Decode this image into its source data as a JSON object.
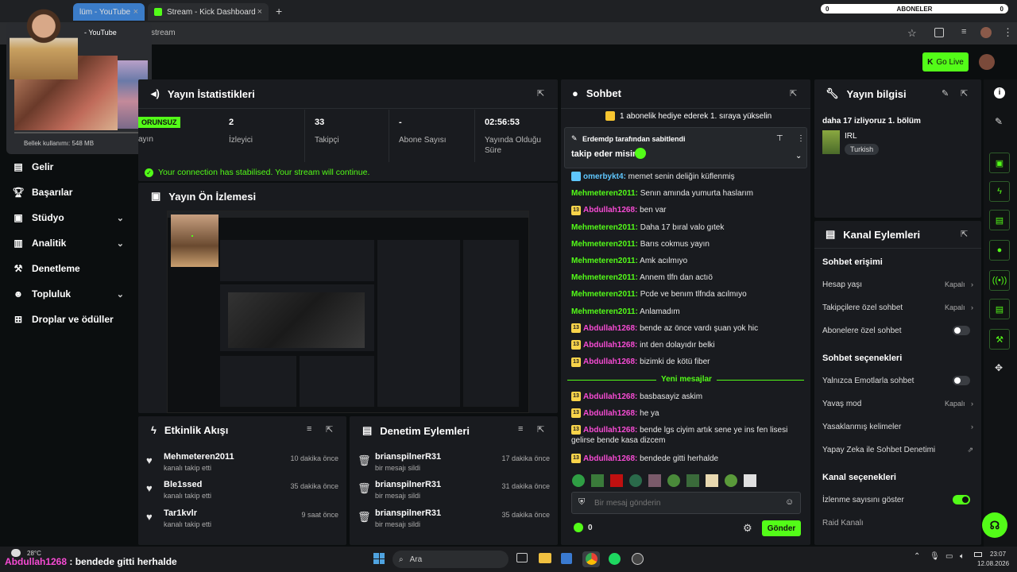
{
  "browser": {
    "tabs": [
      {
        "label": "lüm - YouTube",
        "close": "×"
      },
      {
        "label": "Stream - Kick Dashboard",
        "close": "×"
      }
    ],
    "new_tab": "+",
    "address": "stream"
  },
  "pip": {
    "title": "- YouTube",
    "memory": "Bellek kullanımı: 548 MB"
  },
  "counter": {
    "left": "0",
    "title": "ABONELER",
    "right": "0"
  },
  "header": {
    "go_live": "Go Live"
  },
  "sidebar": {
    "items": [
      {
        "label": "Gelir",
        "icon": "wallet-icon"
      },
      {
        "label": "Başarılar",
        "icon": "trophy-icon"
      },
      {
        "label": "Stüdyo",
        "icon": "studio-icon",
        "chevron": "⌄"
      },
      {
        "label": "Analitik",
        "icon": "chart-icon",
        "chevron": "⌄"
      },
      {
        "label": "Denetleme",
        "icon": "hammer-icon"
      },
      {
        "label": "Topluluk",
        "icon": "people-icon",
        "chevron": "⌄"
      },
      {
        "label": "Droplar ve ödüller",
        "icon": "gift-icon"
      }
    ]
  },
  "stats": {
    "title": "Yayın İstatistikleri",
    "badge": "ORUNSUZ",
    "items": [
      {
        "value": "",
        "label": "ayın"
      },
      {
        "value": "2",
        "label": "İzleyici"
      },
      {
        "value": "33",
        "label": "Takipçi"
      },
      {
        "value": "-",
        "label": "Abone Sayısı"
      },
      {
        "value": "02:56:53",
        "label": "Yayında Olduğu Süre"
      }
    ],
    "notice": "Your connection has stabilised. Your stream will continue."
  },
  "preview": {
    "title": "Yayın Ön İzlemesi"
  },
  "activity": {
    "title": "Etkinlik Akışı",
    "items": [
      {
        "name": "Mehmeteren2011",
        "sub": "kanalı takip etti",
        "time": "10 dakika önce"
      },
      {
        "name": "Ble1ssed",
        "sub": "kanalı takip etti",
        "time": "35 dakika önce"
      },
      {
        "name": "Tar1kvlr",
        "sub": "kanalı takip etti",
        "time": "9 saat önce"
      }
    ]
  },
  "moderation": {
    "title": "Denetim Eylemleri",
    "items": [
      {
        "name": "brianspilnerR31",
        "sub": "bir mesajı sildi",
        "time": "17 dakika önce"
      },
      {
        "name": "brianspilnerR31",
        "sub": "bir mesajı sildi",
        "time": "31 dakika önce"
      },
      {
        "name": "brianspilnerR31",
        "sub": "bir mesajı sildi",
        "time": "35 dakika önce"
      }
    ]
  },
  "chat": {
    "title": "Sohbet",
    "sub_banner": "1 abonelik hediye ederek 1. sıraya yükselin",
    "pinned_by": "Erdemdp tarafından sabitlendi",
    "pinned_text": "takip eder misin",
    "messages": [
      {
        "user": "omerbykt4:",
        "text": " memet senin deliğin küflenmiş",
        "color": "b",
        "badge": ""
      },
      {
        "user": "Mehmeteren2011:",
        "text": " Senın amında yumurta haslarım",
        "color": "g",
        "badge": ""
      },
      {
        "user": "Abdullah1268:",
        "text": " ben var",
        "color": "p",
        "badge": "13"
      },
      {
        "user": "Mehmeteren2011:",
        "text": " Daha 17 bıral valo gıtek",
        "color": "g",
        "badge": ""
      },
      {
        "user": "Mehmeteren2011:",
        "text": " Barıs cokmus yayın",
        "color": "g",
        "badge": ""
      },
      {
        "user": "Mehmeteren2011:",
        "text": " Amk acılmıyo",
        "color": "g",
        "badge": ""
      },
      {
        "user": "Mehmeteren2011:",
        "text": " Annem tlfn dan actıö",
        "color": "g",
        "badge": ""
      },
      {
        "user": "Mehmeteren2011:",
        "text": " Pcde ve benım tlfnda acılmıyo",
        "color": "g",
        "badge": ""
      },
      {
        "user": "Mehmeteren2011:",
        "text": " Anlamadım",
        "color": "g",
        "badge": ""
      },
      {
        "user": "Abdullah1268:",
        "text": " bende az önce vardı şuan yok hic",
        "color": "p",
        "badge": "13"
      },
      {
        "user": "Abdullah1268:",
        "text": " int den dolayıdır belki",
        "color": "p",
        "badge": "13"
      },
      {
        "user": "Abdullah1268:",
        "text": " bizimki de kötü fiber",
        "color": "p",
        "badge": "13"
      }
    ],
    "new_messages": "Yeni mesajlar",
    "messages_after": [
      {
        "user": "Abdullah1268:",
        "text": " basbasayiz askim",
        "color": "p",
        "badge": "13"
      },
      {
        "user": "Abdullah1268:",
        "text": " he ya",
        "color": "p",
        "badge": "13"
      },
      {
        "user": "Abdullah1268:",
        "text": " bende lgs ciyim artık sene ye ins fen lisesi gelirse bende kasa dizcem",
        "color": "p",
        "badge": "13"
      },
      {
        "user": "Abdullah1268:",
        "text": " bendede gitti herhalde",
        "color": "p",
        "badge": "13"
      }
    ],
    "placeholder": "Bir mesaj gönderin",
    "points": "0",
    "send": "Gönder"
  },
  "stream_info": {
    "title": "Yayın bilgisi",
    "stream_title": "daha 17 izliyoruz 1. bölüm",
    "category": "IRL",
    "tag": "Turkish"
  },
  "channel_actions": {
    "title": "Kanal Eylemleri",
    "access_heading": "Sohbet erişimi",
    "access_rows": [
      {
        "label": "Hesap yaşı",
        "value": "Kapalı",
        "kind": "chevron"
      },
      {
        "label": "Takipçilere özel sohbet",
        "value": "Kapalı",
        "kind": "chevron"
      },
      {
        "label": "Abonelere özel sohbet",
        "value": "",
        "kind": "toggle-off"
      }
    ],
    "options_heading": "Sohbet seçenekleri",
    "options_rows": [
      {
        "label": "Yalnızca Emotlarla sohbet",
        "value": "",
        "kind": "toggle-off"
      },
      {
        "label": "Yavaş mod",
        "value": "Kapalı",
        "kind": "chevron"
      },
      {
        "label": "Yasaklanmış kelimeler",
        "value": "",
        "kind": "chevron"
      },
      {
        "label": "Yapay Zeka ile Sohbet Denetimi",
        "value": "",
        "kind": "external"
      }
    ],
    "channel_heading": "Kanal seçenekleri",
    "channel_rows": [
      {
        "label": "İzlenme sayısını göster",
        "value": "",
        "kind": "toggle-on"
      },
      {
        "label": "Raid Kanalı",
        "value": "",
        "kind": "none"
      }
    ]
  },
  "overlay_caption": {
    "user": "Abdullah1268",
    "text": " : bendede gitti herhalde"
  },
  "taskbar": {
    "weather": "28°C",
    "search": "Ara",
    "time": "23:07",
    "date": "12.08.2026"
  },
  "colors": {
    "accent": "#53fc18",
    "panel": "#191b1f",
    "bg": "#0b0e0f",
    "pink": "#f74bd4"
  }
}
